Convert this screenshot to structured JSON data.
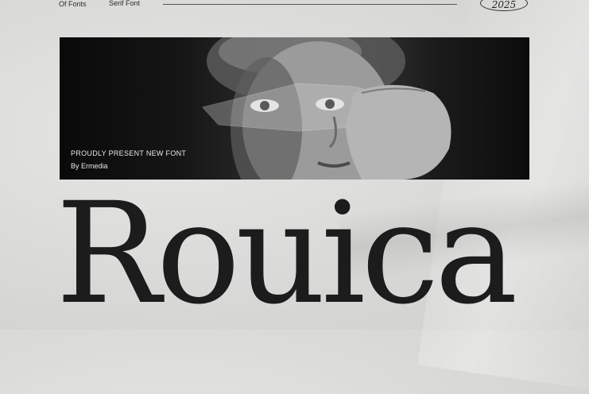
{
  "nav": {
    "left_label": "Of Fonts",
    "mid_label": "Serif Font",
    "year": "2025"
  },
  "hero": {
    "tagline": "PROUDLY PRESENT NEW FONT",
    "byline": "By Ermedia"
  },
  "wordmark": {
    "text": "Rouica"
  },
  "colors": {
    "background": "#d9d9d7",
    "ink": "#1c1c1c",
    "hero_text": "#e9e9e9"
  }
}
